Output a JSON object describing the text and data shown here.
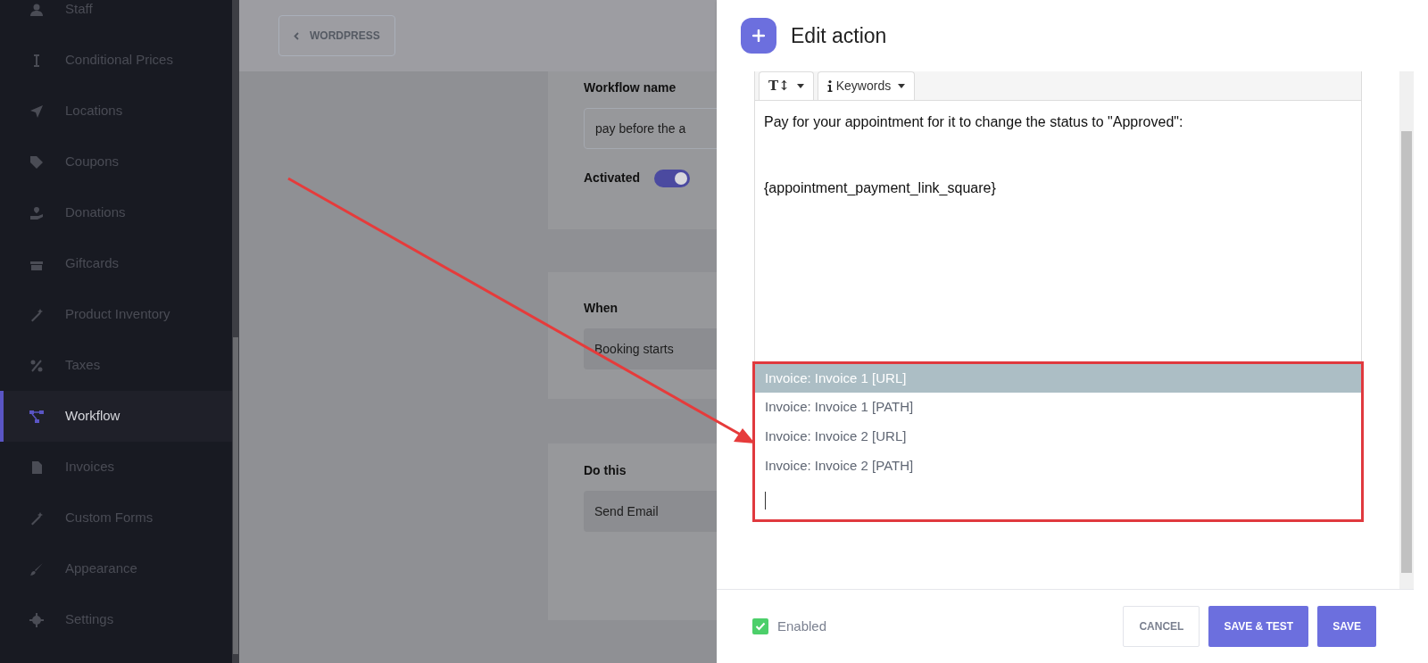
{
  "sidebar": {
    "items": [
      {
        "label": "Staff",
        "selected": false
      },
      {
        "label": "Conditional Prices",
        "selected": false
      },
      {
        "label": "Locations",
        "selected": false
      },
      {
        "label": "Coupons",
        "selected": false
      },
      {
        "label": "Donations",
        "selected": false
      },
      {
        "label": "Giftcards",
        "selected": false
      },
      {
        "label": "Product Inventory",
        "selected": false
      },
      {
        "label": "Taxes",
        "selected": false
      },
      {
        "label": "Workflow",
        "selected": true
      },
      {
        "label": "Invoices",
        "selected": false
      },
      {
        "label": "Custom Forms",
        "selected": false
      },
      {
        "label": "Appearance",
        "selected": false
      },
      {
        "label": "Settings",
        "selected": false
      }
    ]
  },
  "back_button": "WORDPRESS",
  "workflow": {
    "name_label": "Workflow name",
    "name_value": "pay before the a",
    "activated_label": "Activated",
    "activated": true,
    "when_label": "When",
    "when_value": "Booking starts",
    "do_label": "Do this",
    "do_value": "Send Email"
  },
  "modal": {
    "title": "Edit action",
    "toolbar": [
      {
        "kind": "format",
        "label": "T↕"
      },
      {
        "kind": "keywords",
        "label": "Keywords"
      }
    ],
    "body_lines": [
      "Pay for your appointment for it to change the status to \"Approved\":",
      "{appointment_payment_link_square}"
    ],
    "suggestions": [
      {
        "label": "Invoice: Invoice 1 [URL]",
        "selected": true
      },
      {
        "label": "Invoice: Invoice 1 [PATH]",
        "selected": false
      },
      {
        "label": "Invoice: Invoice 2 [URL]",
        "selected": false
      },
      {
        "label": "Invoice: Invoice 2 [PATH]",
        "selected": false
      }
    ],
    "enabled_label": "Enabled",
    "enabled": true,
    "buttons": [
      {
        "kind": "outline",
        "label": "CANCEL"
      },
      {
        "kind": "primary",
        "label": "SAVE & TEST"
      },
      {
        "kind": "primary",
        "label": "SAVE"
      }
    ]
  }
}
